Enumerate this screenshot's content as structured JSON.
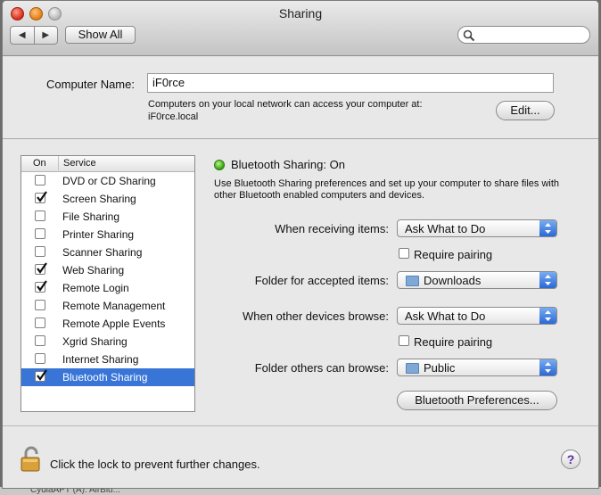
{
  "window": {
    "title": "Sharing",
    "show_all_label": "Show All",
    "back_glyph": "◀",
    "forward_glyph": "▶"
  },
  "computer_name": {
    "label": "Computer Name:",
    "value": "iF0rce",
    "note": "Computers on your local network can access your computer at: iF0rce.local",
    "edit_label": "Edit..."
  },
  "services": {
    "header_on": "On",
    "header_service": "Service",
    "items": [
      {
        "name": "DVD or CD Sharing",
        "checked": false
      },
      {
        "name": "Screen Sharing",
        "checked": true
      },
      {
        "name": "File Sharing",
        "checked": false
      },
      {
        "name": "Printer Sharing",
        "checked": false
      },
      {
        "name": "Scanner Sharing",
        "checked": false
      },
      {
        "name": "Web Sharing",
        "checked": true
      },
      {
        "name": "Remote Login",
        "checked": true
      },
      {
        "name": "Remote Management",
        "checked": false
      },
      {
        "name": "Remote Apple Events",
        "checked": false
      },
      {
        "name": "Xgrid Sharing",
        "checked": false
      },
      {
        "name": "Internet Sharing",
        "checked": false
      },
      {
        "name": "Bluetooth Sharing",
        "checked": true,
        "selected": true
      }
    ]
  },
  "detail": {
    "status": "Bluetooth Sharing: On",
    "status_color": "#33a30c",
    "description": "Use Bluetooth Sharing preferences and set up your computer to share files with other Bluetooth enabled computers and devices.",
    "receiving_label": "When receiving items:",
    "receiving_value": "Ask What to Do",
    "require_pairing_1": "Require pairing",
    "accepted_folder_label": "Folder for accepted items:",
    "accepted_folder_value": "Downloads",
    "browse_label": "When other devices browse:",
    "browse_value": "Ask What to Do",
    "require_pairing_2": "Require pairing",
    "browse_folder_label": "Folder others can browse:",
    "browse_folder_value": "Public",
    "prefs_button": "Bluetooth Preferences..."
  },
  "footer": {
    "lock_text": "Click the lock to prevent further changes.",
    "help_label": "?"
  },
  "background": {
    "partial_text": "CydiaAPT (A): AirBlu..."
  },
  "colors": {
    "selection": "#3875d7",
    "accent": "#2a68d6"
  }
}
